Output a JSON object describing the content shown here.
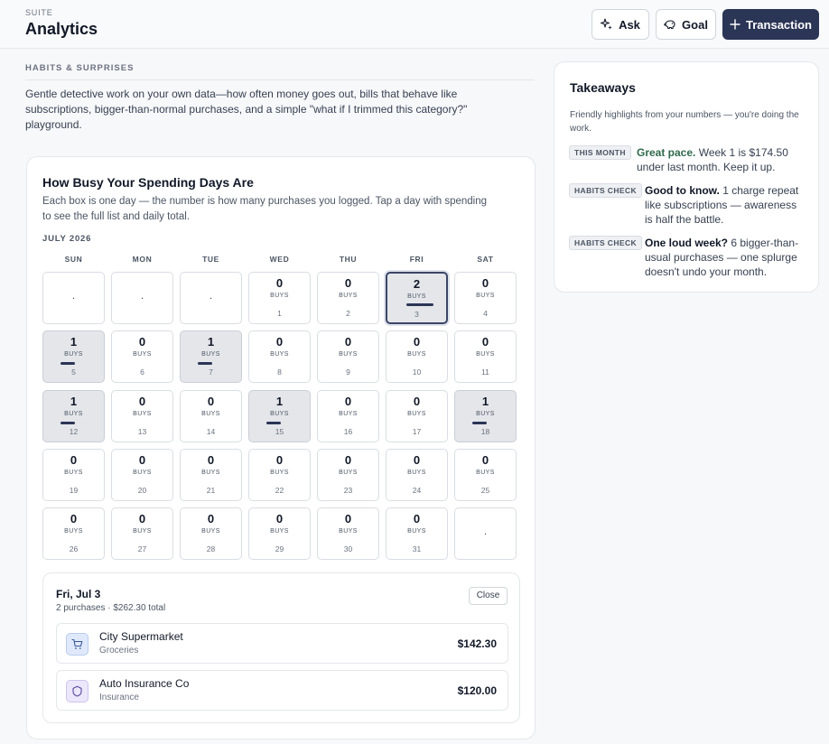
{
  "header": {
    "suite": "SUITE",
    "title": "Analytics",
    "ask_label": "Ask",
    "goal_label": "Goal",
    "transaction_label": "Transaction"
  },
  "section": {
    "label": "HABITS & SURPRISES",
    "intro": "Gentle detective work on your own data—how often money goes out, bills that behave like subscriptions, bigger-than-normal purchases, and a simple \"what if I trimmed this category?\" playground."
  },
  "calendar": {
    "title": "How Busy Your Spending Days Are",
    "description": "Each box is one day — the number is how many purchases you logged. Tap a day with spending to see the full list and daily total.",
    "month": "JULY 2026",
    "weekdays": [
      "SUN",
      "MON",
      "TUE",
      "WED",
      "THU",
      "FRI",
      "SAT"
    ],
    "buys_label": "BUYS",
    "blank_mark": ".",
    "selected_day": "3",
    "days": [
      {
        "day": "1",
        "count": "0"
      },
      {
        "day": "2",
        "count": "0"
      },
      {
        "day": "3",
        "count": "2"
      },
      {
        "day": "4",
        "count": "0"
      },
      {
        "day": "5",
        "count": "1"
      },
      {
        "day": "6",
        "count": "0"
      },
      {
        "day": "7",
        "count": "1"
      },
      {
        "day": "8",
        "count": "0"
      },
      {
        "day": "9",
        "count": "0"
      },
      {
        "day": "10",
        "count": "0"
      },
      {
        "day": "11",
        "count": "0"
      },
      {
        "day": "12",
        "count": "1"
      },
      {
        "day": "13",
        "count": "0"
      },
      {
        "day": "14",
        "count": "0"
      },
      {
        "day": "15",
        "count": "1"
      },
      {
        "day": "16",
        "count": "0"
      },
      {
        "day": "17",
        "count": "0"
      },
      {
        "day": "18",
        "count": "1"
      },
      {
        "day": "19",
        "count": "0"
      },
      {
        "day": "20",
        "count": "0"
      },
      {
        "day": "21",
        "count": "0"
      },
      {
        "day": "22",
        "count": "0"
      },
      {
        "day": "23",
        "count": "0"
      },
      {
        "day": "24",
        "count": "0"
      },
      {
        "day": "25",
        "count": "0"
      },
      {
        "day": "26",
        "count": "0"
      },
      {
        "day": "27",
        "count": "0"
      },
      {
        "day": "28",
        "count": "0"
      },
      {
        "day": "29",
        "count": "0"
      },
      {
        "day": "30",
        "count": "0"
      },
      {
        "day": "31",
        "count": "0"
      }
    ]
  },
  "detail": {
    "date": "Fri, Jul 3",
    "summary": "2 purchases · $262.30 total",
    "close_label": "Close",
    "transactions": [
      {
        "name": "City Supermarket",
        "category": "Groceries",
        "amount": "$142.30",
        "icon": "cart-icon"
      },
      {
        "name": "Auto Insurance Co",
        "category": "Insurance",
        "amount": "$120.00",
        "icon": "shield-icon"
      }
    ]
  },
  "takeaways": {
    "title": "Takeaways",
    "subtitle": "Friendly highlights from your numbers — you're doing the work.",
    "items": [
      {
        "badge": "THIS MONTH",
        "lead": "Great pace.",
        "text": " Week 1 is $174.50 under last month. Keep it up."
      },
      {
        "badge": "HABITS CHECK",
        "lead": "Good to know.",
        "text": " 1 charge repeat like subscriptions — awareness is half the battle."
      },
      {
        "badge": "HABITS CHECK",
        "lead": "One loud week?",
        "text": " 6 bigger-than-usual purchases — one splurge doesn't undo your month."
      }
    ]
  },
  "colors": {
    "accent": "#2b3556",
    "busy_cell": "#e4e6ea",
    "positive": "#2f6a4c"
  }
}
